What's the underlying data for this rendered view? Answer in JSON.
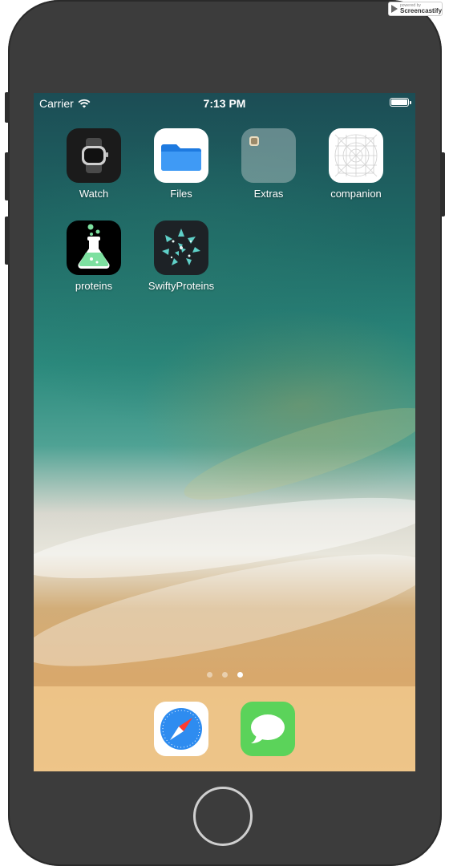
{
  "watermark": {
    "small": "powered by",
    "brand": "Screencastify"
  },
  "status_bar": {
    "carrier": "Carrier",
    "time": "7:13 PM"
  },
  "home_apps": [
    {
      "label": "Watch"
    },
    {
      "label": "Files"
    },
    {
      "label": "Extras"
    },
    {
      "label": "companion"
    },
    {
      "label": "proteins"
    },
    {
      "label": "SwiftyProteins"
    }
  ],
  "dock": {
    "apps": [
      {
        "name": "Safari"
      },
      {
        "name": "Messages"
      }
    ]
  },
  "page_indicator": {
    "pages": 3,
    "current": 3
  },
  "colors": {
    "phone_frame": "#3c3c3c",
    "dock": "#f0c88c",
    "messages_green": "#5bd35a",
    "safari_blue": "#2e8cf0"
  }
}
